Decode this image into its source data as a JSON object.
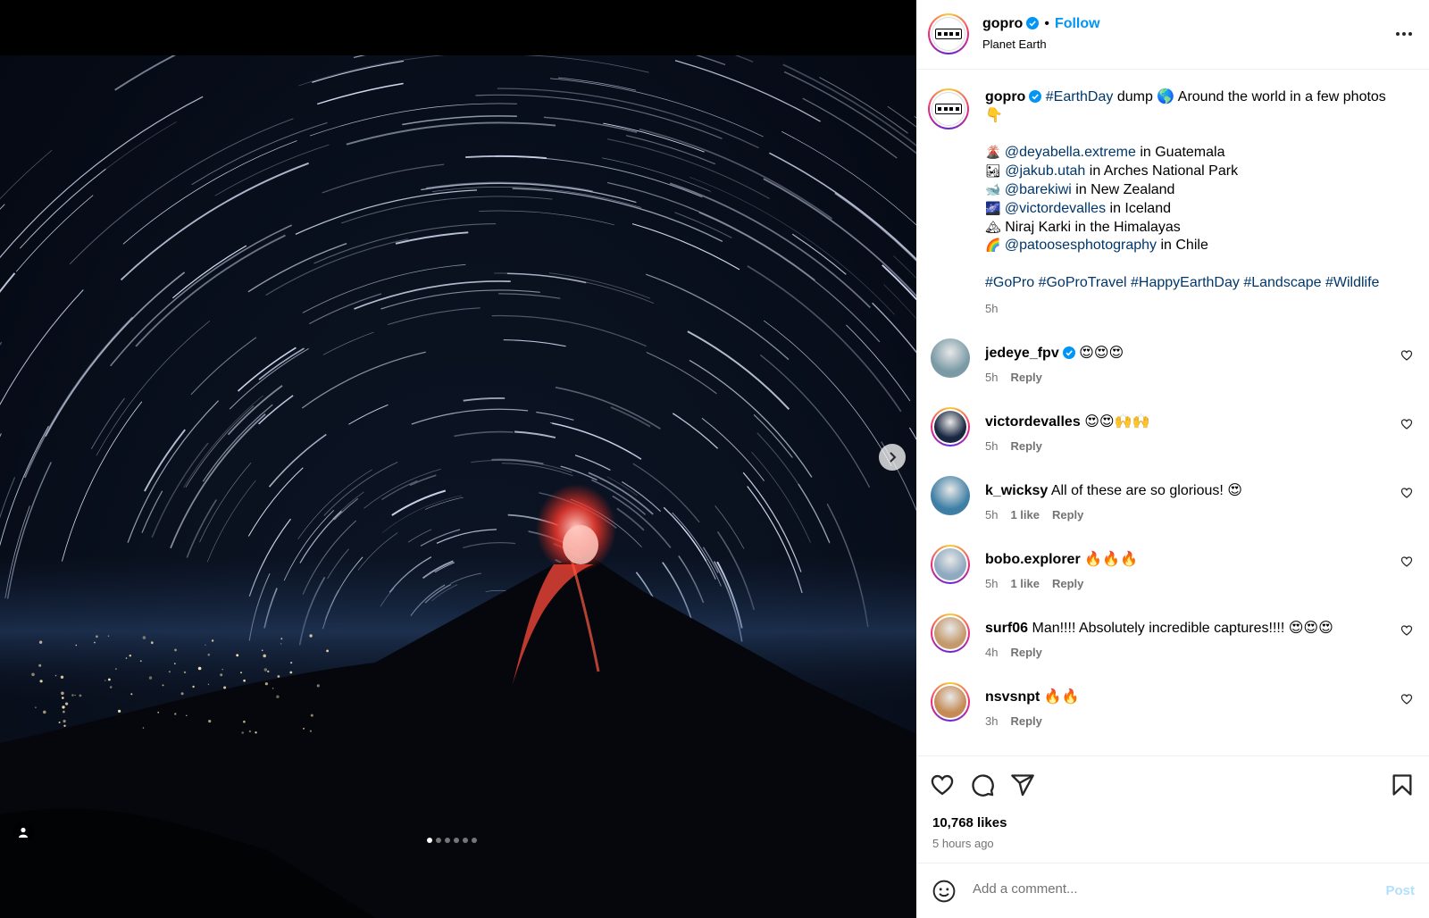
{
  "post": {
    "username": "gopro",
    "follow_label": "Follow",
    "dot": "•",
    "location": "Planet Earth",
    "more_label": "•••"
  },
  "caption": {
    "username": "gopro",
    "line1_hashtag": "#EarthDay",
    "line1_rest": " dump 🌎 Around the world in a few photos 👇",
    "credits": [
      {
        "emoji": "🌋",
        "handle": "@deyabella.extreme",
        "rest": " in Guatemala"
      },
      {
        "emoji": "🏜",
        "handle": "@jakub.utah",
        "rest": " in Arches National Park"
      },
      {
        "emoji": "🐋",
        "handle": "@barekiwi",
        "rest": " in New Zealand"
      },
      {
        "emoji": "🌌",
        "handle": "@victordevalles",
        "rest": " in Iceland"
      },
      {
        "emoji": "🏔",
        "handle": "",
        "rest": "Niraj Karki in the Himalayas"
      },
      {
        "emoji": "🌈",
        "handle": "@patoosesphotography",
        "rest": " in Chile"
      }
    ],
    "hashtags": "#GoPro #GoProTravel #HappyEarthDay #Landscape #Wildlife",
    "time": "5h"
  },
  "comments": [
    {
      "user": "jedeye_fpv",
      "verified": true,
      "text": "😍😍😍",
      "time": "5h",
      "likes": "",
      "reply": "Reply",
      "avatar_color": "#7a9aa6",
      "ring": false
    },
    {
      "user": "victordevalles",
      "verified": false,
      "text": "😍😍🙌🙌",
      "time": "5h",
      "likes": "",
      "reply": "Reply",
      "avatar_color": "#1a2640",
      "ring": true
    },
    {
      "user": "k_wicksy",
      "verified": false,
      "text": "All of these are so glorious! 😍",
      "time": "5h",
      "likes": "1 like",
      "reply": "Reply",
      "avatar_color": "#3f7fa5",
      "ring": false
    },
    {
      "user": "bobo.explorer",
      "verified": false,
      "text": "🔥🔥🔥",
      "time": "5h",
      "likes": "1 like",
      "reply": "Reply",
      "avatar_color": "#8fa9c0",
      "ring": true
    },
    {
      "user": "surf06",
      "verified": false,
      "text": "Man!!!! Absolutely incredible captures!!!! 😍😍😍",
      "time": "4h",
      "likes": "",
      "reply": "Reply",
      "avatar_color": "#c49a6c",
      "ring": true
    },
    {
      "user": "nsvsnpt",
      "verified": false,
      "text": "🔥🔥",
      "time": "3h",
      "likes": "",
      "reply": "Reply",
      "avatar_color": "#c58a55",
      "ring": true
    }
  ],
  "footer": {
    "likes": "10,768 likes",
    "ago": "5 hours ago",
    "comment_placeholder": "Add a comment...",
    "post_label": "Post"
  },
  "carousel": {
    "count": 6,
    "active": 0
  },
  "colors": {
    "link": "#00376b",
    "follow": "#0095f6",
    "muted": "#737373"
  }
}
